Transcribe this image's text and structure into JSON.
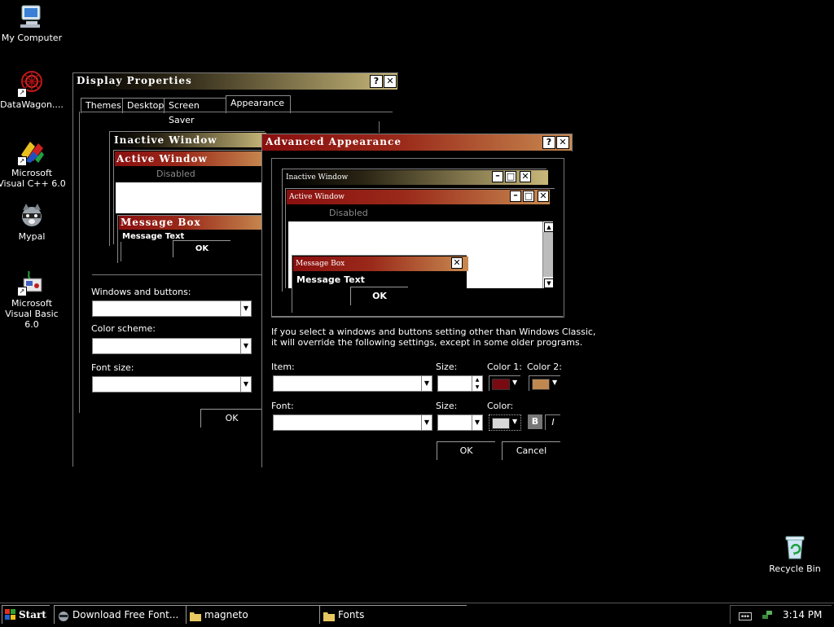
{
  "desktop": {
    "icons": [
      {
        "label": "My Computer",
        "icon": "my-computer-icon"
      },
      {
        "label": "DataWagon....",
        "icon": "datawagon-icon"
      },
      {
        "label": "Microsoft Visual C++ 6.0",
        "icon": "visual-cpp-icon"
      },
      {
        "label": "Mypal",
        "icon": "mypal-icon"
      },
      {
        "label": "Microsoft Visual Basic 6.0",
        "icon": "visual-basic-icon"
      },
      {
        "label": "Recycle Bin",
        "icon": "recycle-bin-icon"
      }
    ]
  },
  "display_properties": {
    "title": "Display Properties",
    "help": "?",
    "close": "✕",
    "tabs": [
      "Themes",
      "Desktop",
      "Screen Saver",
      "Appearance"
    ],
    "active_tab": "Appearance",
    "preview": {
      "inactive_title": "Inactive Window",
      "active_title": "Active Window",
      "disabled": "Disabled",
      "message_box_title": "Message Box",
      "message_text": "Message Text",
      "ok": "OK"
    },
    "windows_and_buttons_label": "Windows and buttons:",
    "color_scheme_label": "Color scheme:",
    "font_size_label": "Font size:",
    "windows_and_buttons_value": "",
    "color_scheme_value": "",
    "font_size_value": "",
    "ok_button": "OK"
  },
  "advanced_appearance": {
    "title": "Advanced Appearance",
    "help": "?",
    "close": "✕",
    "preview": {
      "inactive_title": "Inactive Window",
      "active_title": "Active Window",
      "disabled": "Disabled",
      "message_box_title": "Message Box",
      "message_text": "Message Text",
      "ok": "OK"
    },
    "info_line1": "If you select a windows and buttons setting other than Windows Classic,",
    "info_line2": "it will override the following settings, except in some older programs.",
    "item_label": "Item:",
    "item_value": "",
    "item_size_label": "Size:",
    "item_size_value": "",
    "color1_label": "Color 1:",
    "color2_label": "Color 2:",
    "color1": "#7a0a12",
    "color2": "#c08850",
    "font_label": "Font:",
    "font_value": "",
    "font_size_label": "Size:",
    "font_size_value": "",
    "font_color_label": "Color:",
    "font_color": "#d8d8d8",
    "bold": "B",
    "italic": "I",
    "ok_button": "OK",
    "cancel_button": "Cancel"
  },
  "taskbar": {
    "start": "Start",
    "tasks": [
      {
        "label": "Download Free Font...",
        "icon": "mypal-icon"
      },
      {
        "label": "magneto",
        "icon": "folder-icon"
      },
      {
        "label": "Fonts",
        "icon": "folder-icon"
      }
    ],
    "clock": "3:14 PM"
  },
  "colors": {
    "active_title_start": "#8a0f0f",
    "active_title_end": "#c88a50",
    "inactive_title_end": "#c8b87a"
  }
}
